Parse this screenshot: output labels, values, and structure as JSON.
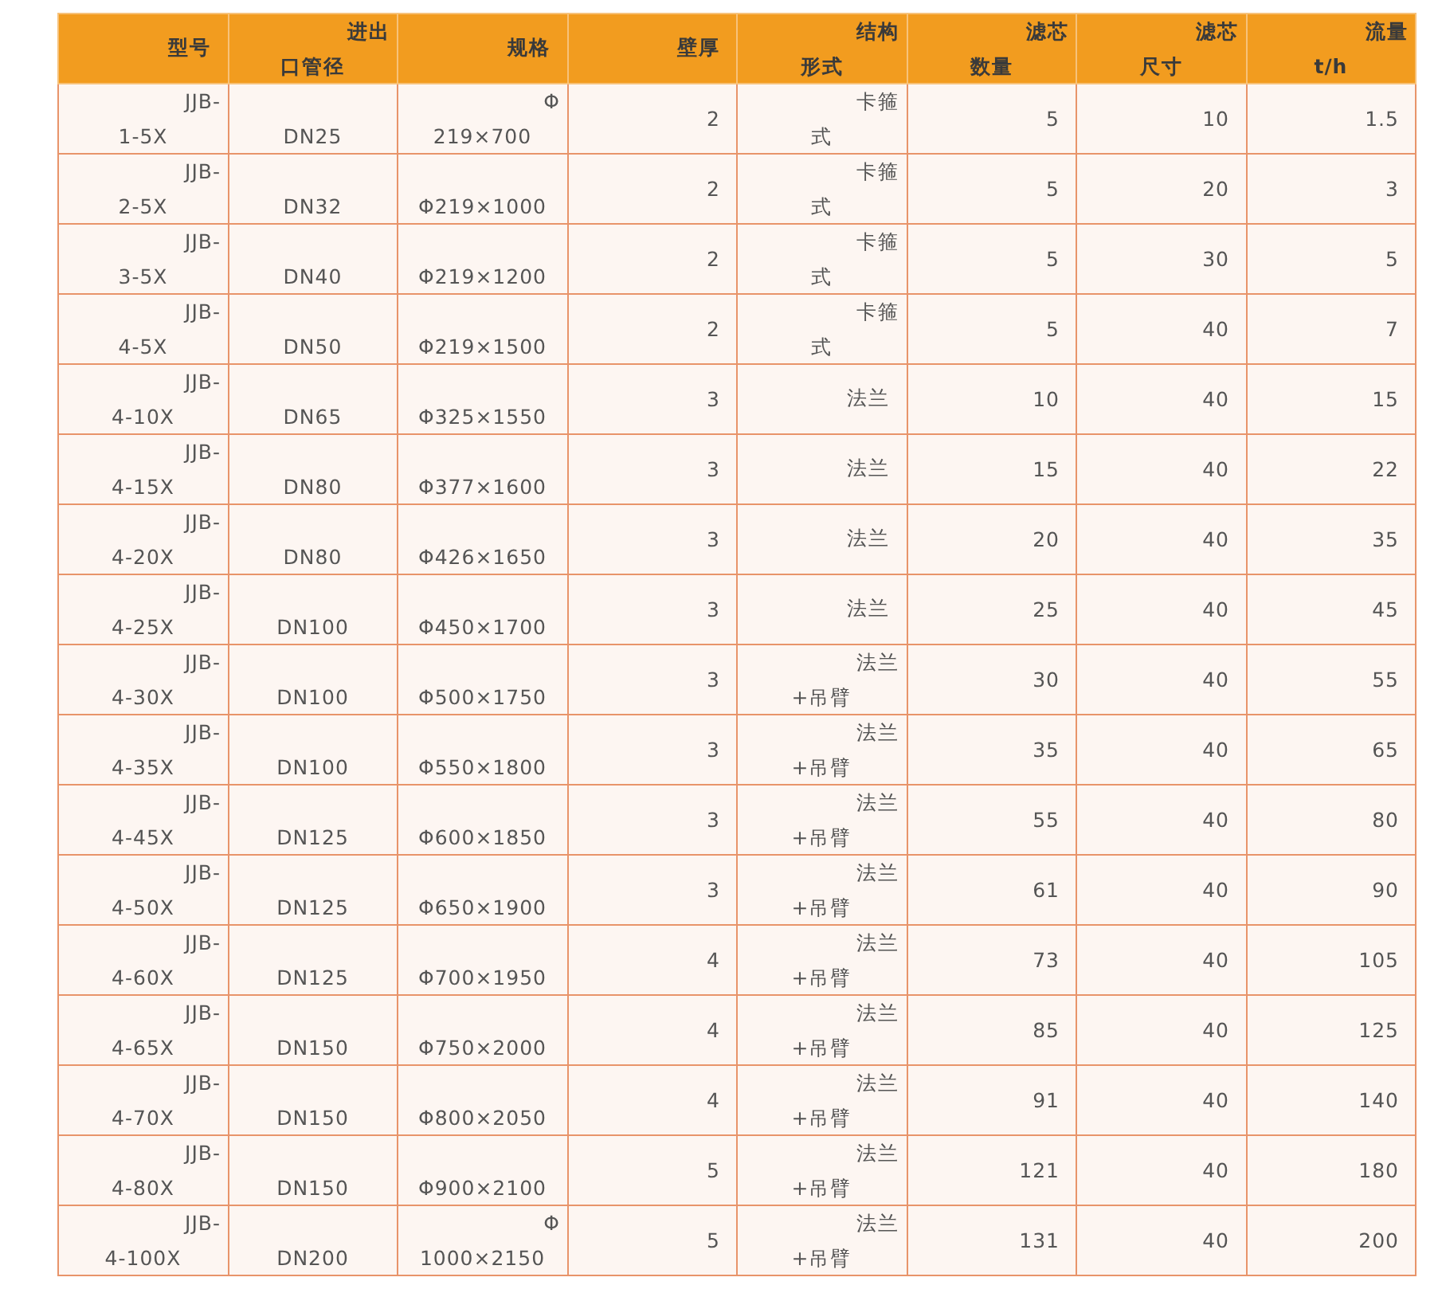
{
  "table": {
    "columns": [
      "型号",
      {
        "top": "进出",
        "bottom": "口管径"
      },
      "规格",
      "壁厚",
      {
        "top": "结构",
        "bottom": "形式"
      },
      {
        "top": "滤芯",
        "bottom": "数量"
      },
      {
        "top": "滤芯",
        "bottom": "尺寸"
      },
      {
        "top": "流量",
        "bottom": "t/h"
      }
    ],
    "rows": [
      [
        {
          "top": "JJB-",
          "bottom": "1-5X"
        },
        {
          "bottom": "DN25"
        },
        {
          "top": "Φ",
          "bottom": "219×700"
        },
        "2",
        {
          "top": "卡箍",
          "bottom": "式"
        },
        "5",
        "10",
        "1.5"
      ],
      [
        {
          "top": "JJB-",
          "bottom": "2-5X"
        },
        {
          "bottom": "DN32"
        },
        {
          "bottom": "Φ219×1000"
        },
        "2",
        {
          "top": "卡箍",
          "bottom": "式"
        },
        "5",
        "20",
        "3"
      ],
      [
        {
          "top": "JJB-",
          "bottom": "3-5X"
        },
        {
          "bottom": "DN40"
        },
        {
          "bottom": "Φ219×1200"
        },
        "2",
        {
          "top": "卡箍",
          "bottom": "式"
        },
        "5",
        "30",
        "5"
      ],
      [
        {
          "top": "JJB-",
          "bottom": "4-5X"
        },
        {
          "bottom": "DN50"
        },
        {
          "bottom": "Φ219×1500"
        },
        "2",
        {
          "top": "卡箍",
          "bottom": "式"
        },
        "5",
        "40",
        "7"
      ],
      [
        {
          "top": "JJB-",
          "bottom": "4-10X"
        },
        {
          "bottom": "DN65"
        },
        {
          "bottom": "Φ325×1550"
        },
        "3",
        "法兰",
        "10",
        "40",
        "15"
      ],
      [
        {
          "top": "JJB-",
          "bottom": "4-15X"
        },
        {
          "bottom": "DN80"
        },
        {
          "bottom": "Φ377×1600"
        },
        "3",
        "法兰",
        "15",
        "40",
        "22"
      ],
      [
        {
          "top": "JJB-",
          "bottom": "4-20X"
        },
        {
          "bottom": "DN80"
        },
        {
          "bottom": "Φ426×1650"
        },
        "3",
        "法兰",
        "20",
        "40",
        "35"
      ],
      [
        {
          "top": "JJB-",
          "bottom": "4-25X"
        },
        {
          "bottom": "DN100"
        },
        {
          "bottom": "Φ450×1700"
        },
        "3",
        "法兰",
        "25",
        "40",
        "45"
      ],
      [
        {
          "top": "JJB-",
          "bottom": "4-30X"
        },
        {
          "bottom": "DN100"
        },
        {
          "bottom": "Φ500×1750"
        },
        "3",
        {
          "top": "法兰",
          "bottom": "+吊臂"
        },
        "30",
        "40",
        "55"
      ],
      [
        {
          "top": "JJB-",
          "bottom": "4-35X"
        },
        {
          "bottom": "DN100"
        },
        {
          "bottom": "Φ550×1800"
        },
        "3",
        {
          "top": "法兰",
          "bottom": "+吊臂"
        },
        "35",
        "40",
        "65"
      ],
      [
        {
          "top": "JJB-",
          "bottom": "4-45X"
        },
        {
          "bottom": "DN125"
        },
        {
          "bottom": "Φ600×1850"
        },
        "3",
        {
          "top": "法兰",
          "bottom": "+吊臂"
        },
        "55",
        "40",
        "80"
      ],
      [
        {
          "top": "JJB-",
          "bottom": "4-50X"
        },
        {
          "bottom": "DN125"
        },
        {
          "bottom": "Φ650×1900"
        },
        "3",
        {
          "top": "法兰",
          "bottom": "+吊臂"
        },
        "61",
        "40",
        "90"
      ],
      [
        {
          "top": "JJB-",
          "bottom": "4-60X"
        },
        {
          "bottom": "DN125"
        },
        {
          "bottom": "Φ700×1950"
        },
        "4",
        {
          "top": "法兰",
          "bottom": "+吊臂"
        },
        "73",
        "40",
        "105"
      ],
      [
        {
          "top": "JJB-",
          "bottom": "4-65X"
        },
        {
          "bottom": "DN150"
        },
        {
          "bottom": "Φ750×2000"
        },
        "4",
        {
          "top": "法兰",
          "bottom": "+吊臂"
        },
        "85",
        "40",
        "125"
      ],
      [
        {
          "top": "JJB-",
          "bottom": "4-70X"
        },
        {
          "bottom": "DN150"
        },
        {
          "bottom": "Φ800×2050"
        },
        "4",
        {
          "top": "法兰",
          "bottom": "+吊臂"
        },
        "91",
        "40",
        "140"
      ],
      [
        {
          "top": "JJB-",
          "bottom": "4-80X"
        },
        {
          "bottom": "DN150"
        },
        {
          "bottom": "Φ900×2100"
        },
        "5",
        {
          "top": "法兰",
          "bottom": "+吊臂"
        },
        "121",
        "40",
        "180"
      ],
      [
        {
          "top": "JJB-",
          "bottom": "4-100X"
        },
        {
          "bottom": "DN200"
        },
        {
          "top": "Φ",
          "bottom": "1000×2150"
        },
        "5",
        {
          "top": "法兰",
          "bottom": "+吊臂"
        },
        "131",
        "40",
        "200"
      ]
    ]
  }
}
